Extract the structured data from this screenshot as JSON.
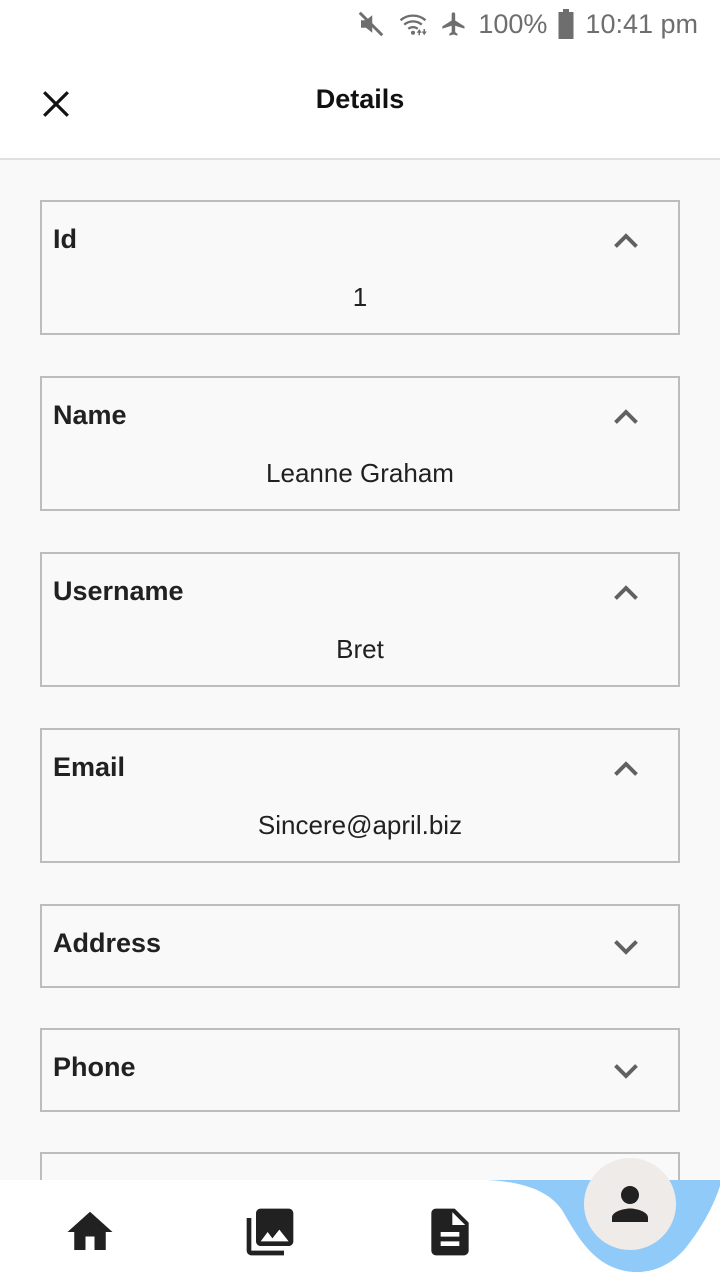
{
  "status_bar": {
    "battery": "100%",
    "time": "10:41 pm",
    "icons": [
      "mute-icon",
      "wifi-icon",
      "airplane-icon",
      "battery-icon"
    ]
  },
  "app_bar": {
    "title": "Details",
    "close_icon": "close-icon"
  },
  "panels": [
    {
      "label": "Id",
      "value": "1",
      "expanded": true
    },
    {
      "label": "Name",
      "value": "Leanne Graham",
      "expanded": true
    },
    {
      "label": "Username",
      "value": "Bret",
      "expanded": true
    },
    {
      "label": "Email",
      "value": "Sincere@april.biz",
      "expanded": true
    },
    {
      "label": "Address",
      "expanded": false
    },
    {
      "label": "Phone",
      "expanded": false
    }
  ],
  "bottom_nav": {
    "items": [
      "home-icon",
      "photo-library-icon",
      "document-icon",
      "person-icon"
    ],
    "active_index": 3,
    "accent_color": "#90caf9"
  }
}
